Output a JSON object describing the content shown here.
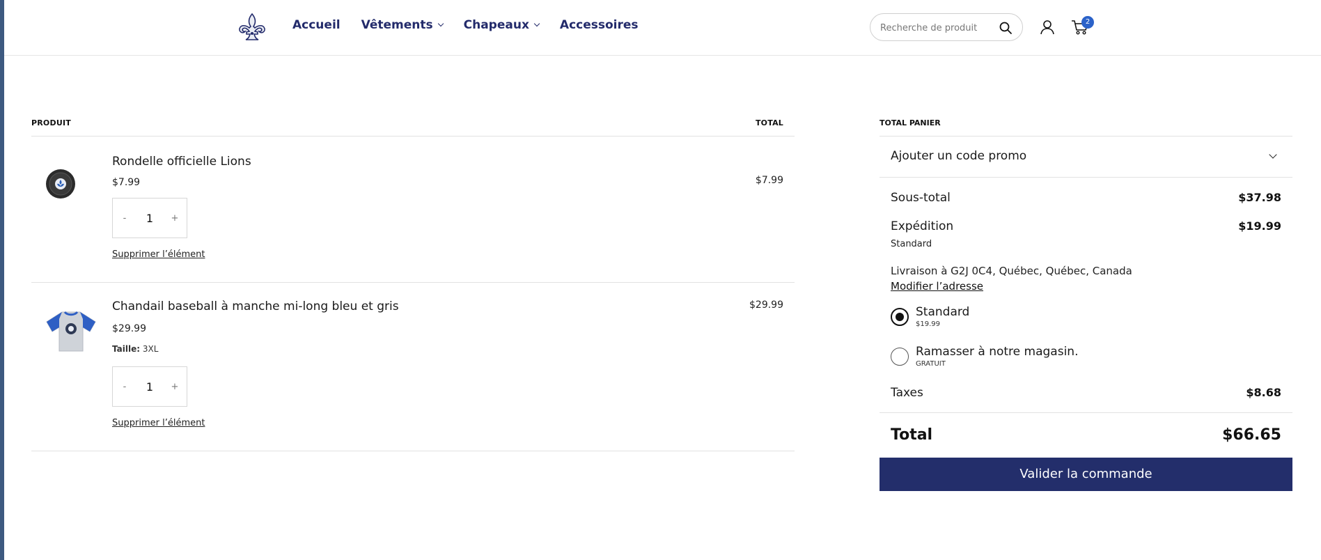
{
  "nav": {
    "items": [
      {
        "label": "Accueil",
        "dropdown": false
      },
      {
        "label": "Vêtements",
        "dropdown": true
      },
      {
        "label": "Chapeaux",
        "dropdown": true
      },
      {
        "label": "Accessoires",
        "dropdown": false
      }
    ]
  },
  "search": {
    "placeholder": "Recherche de produit"
  },
  "cart_count": "2",
  "cart": {
    "col_product": "PRODUIT",
    "col_total": "TOTAL",
    "items": [
      {
        "name": "Rondelle officielle Lions",
        "price": "$7.99",
        "quantity": "1",
        "line_total": "$7.99",
        "remove_label": "Supprimer l’élément"
      },
      {
        "name": "Chandail baseball à manche mi-long bleu et gris",
        "price": "$29.99",
        "attr_label": "Taille:",
        "attr_value": "3XL",
        "quantity": "1",
        "line_total": "$29.99",
        "remove_label": "Supprimer l’élément"
      }
    ],
    "qty_minus": "-",
    "qty_plus": "+"
  },
  "summary": {
    "title": "TOTAL PANIER",
    "promo_label": "Ajouter un code promo",
    "subtotal_label": "Sous-total",
    "subtotal_value": "$37.98",
    "shipping_label": "Expédition",
    "shipping_value": "$19.99",
    "shipping_method": "Standard",
    "shipping_address": "Livraison à G2J 0C4, Québec, Québec, Canada",
    "modify_address": "Modifier l’adresse",
    "options": [
      {
        "title": "Standard",
        "sub": "$19.99",
        "selected": true
      },
      {
        "title": "Ramasser à notre magasin.",
        "sub": "GRATUIT",
        "selected": false
      }
    ],
    "taxes_label": "Taxes",
    "taxes_value": "$8.68",
    "total_label": "Total",
    "total_value": "$66.65",
    "checkout_label": "Valider la commande"
  },
  "colors": {
    "brand_navy": "#232e6b",
    "badge_blue": "#2b62c9"
  }
}
